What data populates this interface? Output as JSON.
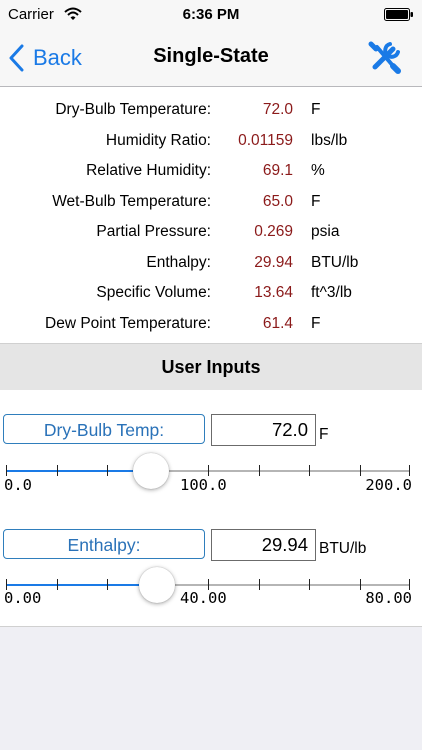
{
  "status_bar": {
    "carrier": "Carrier",
    "time": "6:36 PM"
  },
  "nav": {
    "back_label": "Back",
    "title": "Single-State"
  },
  "results": [
    {
      "label": "Dry-Bulb Temperature:",
      "value": "72.0",
      "unit": "F"
    },
    {
      "label": "Humidity Ratio:",
      "value": "0.01159",
      "unit": "lbs/lb"
    },
    {
      "label": "Relative Humidity:",
      "value": "69.1",
      "unit": "%"
    },
    {
      "label": "Wet-Bulb Temperature:",
      "value": "65.0",
      "unit": "F"
    },
    {
      "label": "Partial Pressure:",
      "value": "0.269",
      "unit": "psia"
    },
    {
      "label": "Enthalpy:",
      "value": "29.94",
      "unit": "BTU/lb"
    },
    {
      "label": "Specific Volume:",
      "value": "13.64",
      "unit": "ft^3/lb"
    },
    {
      "label": "Dew Point Temperature:",
      "value": "61.4",
      "unit": "F"
    }
  ],
  "user_inputs": {
    "title": "User Inputs",
    "dry_bulb": {
      "button_label": "Dry-Bulb Temp:",
      "value": "72.0",
      "unit": "F",
      "slider": {
        "min": 0,
        "max": 200,
        "value": 72.0,
        "labels": [
          "0.0",
          "100.0",
          "200.0"
        ]
      }
    },
    "enthalpy": {
      "button_label": "Enthalpy:",
      "value": "29.94",
      "unit": "BTU/lb",
      "slider": {
        "min": 0,
        "max": 80,
        "value": 29.94,
        "labels": [
          "0.00",
          "40.00",
          "80.00"
        ]
      }
    }
  },
  "colors": {
    "accent": "#1a7ae6",
    "value_text": "#8b1a1a",
    "button_text": "#2a72b8"
  },
  "icons": {
    "back": "chevron-left-icon",
    "tools": "wrench-screwdriver-icon",
    "wifi": "wifi-icon",
    "battery": "battery-icon"
  }
}
